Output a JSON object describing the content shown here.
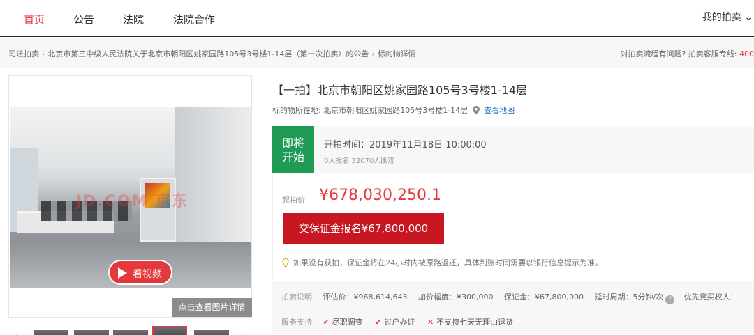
{
  "nav": {
    "items": [
      "首页",
      "公告",
      "法院",
      "法院合作"
    ],
    "my_auction": "我的拍卖 ⌄"
  },
  "breadcrumb": {
    "items": [
      "司法拍卖",
      "北京市第三中级人民法院关于北京市朝阳区姚家园路105号3号楼1-14层（第一次拍卖）的公告",
      "标的物详情"
    ],
    "help_text": "对拍卖流程有问题? 拍卖客服专线:",
    "help_phone": "400"
  },
  "gallery": {
    "watermark": "JD.COM 京东",
    "play_label": "看视频",
    "detail_label": "点击查看图片详情"
  },
  "item": {
    "title": "【一拍】北京市朝阳区姚家园路105号3号楼1-14层",
    "location_prefix": "标的物所在地:",
    "location": "北京市朝阳区姚家园路105号3号楼1-14层",
    "map_link": "查看地图"
  },
  "status": {
    "badge": "即将\n开始",
    "badge_line1": "即将",
    "badge_line2": "开始",
    "start_time": "开拍时间：2019年11月18日 10:00:00",
    "counts": "0人报名 32070人围观"
  },
  "price": {
    "label": "起拍价",
    "value": "¥678,030,250.1",
    "deposit_button": "交保证金报名¥67,800,000",
    "tip": "如果没有获拍，保证金将在24小时内被原路返还，具体到账时间需要以银行信息提示为准。"
  },
  "info": {
    "desc_label": "拍卖说明",
    "appraisal": "评估价：¥968,614,643",
    "increment": "加价幅度：¥300,000",
    "deposit": "保证金：¥67,800,000",
    "delay": "延时周期：5分钟/次",
    "priority": "优先竞买权人：",
    "service_label": "服务支持",
    "services": [
      "尽职调查",
      "过户办证",
      "不支持七天无理由退货"
    ]
  },
  "colors": {
    "accent": "#e4393c",
    "deposit_button": "#c81623",
    "status_badge": "#1f9a55",
    "link": "#1a67c7"
  }
}
